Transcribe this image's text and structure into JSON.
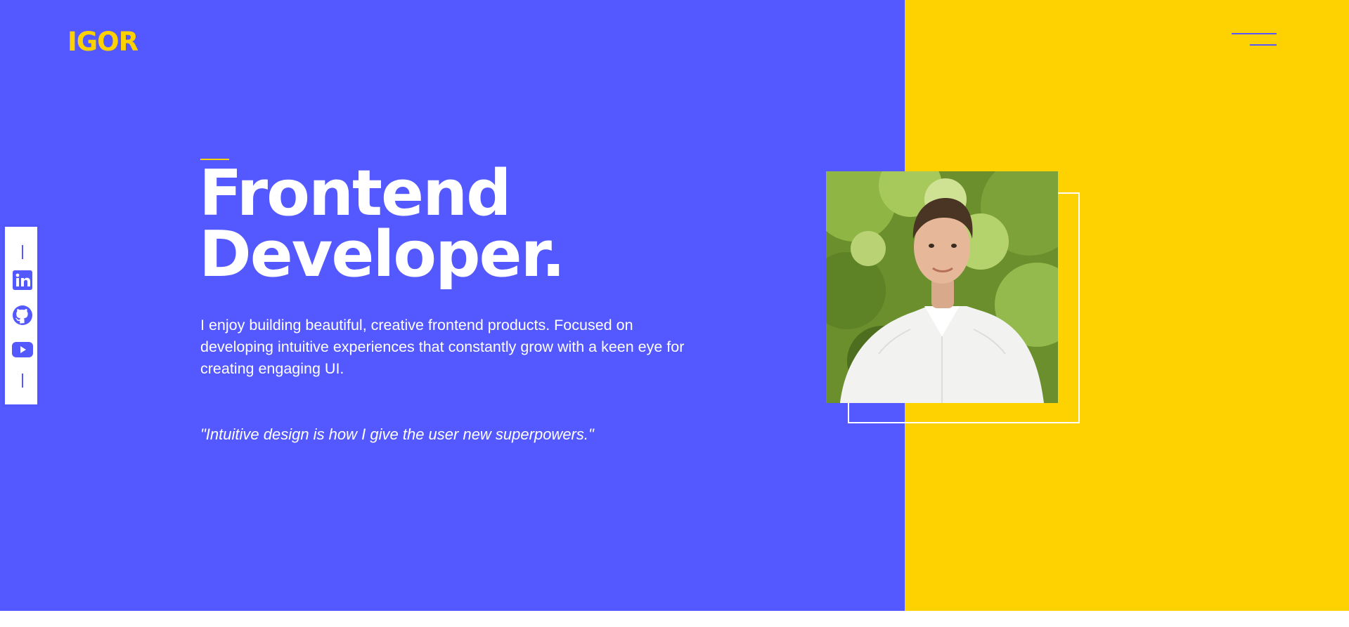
{
  "header": {
    "logo_text": "IGOR",
    "menu_icon": "hamburger-menu-icon"
  },
  "hero": {
    "headline_line1": "Frontend",
    "headline_line2": "Developer.",
    "intro": "I enjoy building beautiful, creative frontend products. Focused on developing intuitive experiences that constantly grow with a keen eye for creating engaging UI.",
    "quote": "\"Intuitive design is how I give the user new superpowers.\"",
    "photo_icon": "portrait-photo"
  },
  "social": {
    "items": [
      {
        "icon": "linkedin-icon"
      },
      {
        "icon": "github-icon"
      },
      {
        "icon": "youtube-icon"
      }
    ]
  },
  "colors": {
    "primary": "#5458FF",
    "accent": "#FED100",
    "text": "#FFFFFF"
  }
}
